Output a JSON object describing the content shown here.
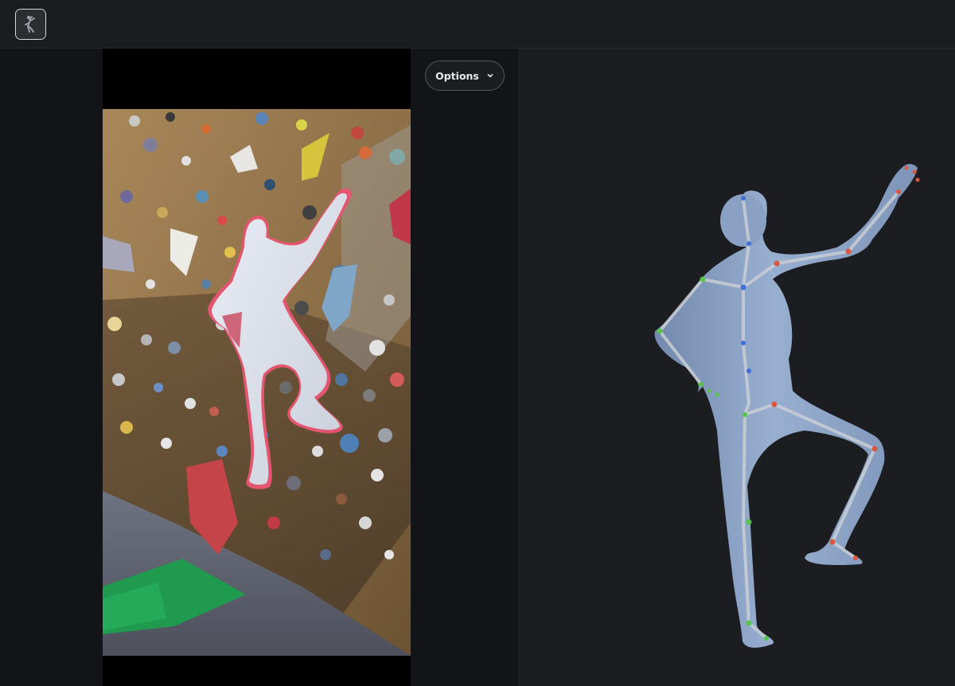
{
  "header": {
    "thumbnail_icon": "climber-thumbnail-icon"
  },
  "toolbar": {
    "options_label": "Options",
    "options_icon": "chevron-down-icon"
  },
  "colors": {
    "background": "#131417",
    "header": "#1b1c1f",
    "viewer": "#1c1d21",
    "body_mesh": "#8ea6c8",
    "segmentation_outline": "#e4566f",
    "joint_left": "#57c34a",
    "joint_right": "#d9563f",
    "joint_center": "#3f6fd6"
  }
}
